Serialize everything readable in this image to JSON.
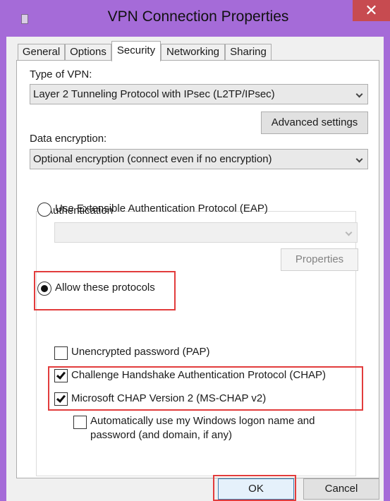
{
  "window": {
    "title": "VPN Connection Properties",
    "close_glyph": "✕"
  },
  "tabs": [
    {
      "label": "General",
      "active": false
    },
    {
      "label": "Options",
      "active": false
    },
    {
      "label": "Security",
      "active": true
    },
    {
      "label": "Networking",
      "active": false
    },
    {
      "label": "Sharing",
      "active": false
    }
  ],
  "security": {
    "vpn_type_label": "Type of VPN:",
    "vpn_type_value": "Layer 2 Tunneling Protocol with IPsec (L2TP/IPsec)",
    "advanced_settings_label": "Advanced settings",
    "data_encryption_label": "Data encryption:",
    "data_encryption_value": "Optional encryption (connect even if no encryption)",
    "authentication": {
      "group_label": "Authentication",
      "eap_label": "Use Extensible Authentication Protocol (EAP)",
      "eap_selected": false,
      "eap_dropdown_value": "",
      "properties_label": "Properties",
      "allow_label": "Allow these protocols",
      "allow_selected": true,
      "protocols": [
        {
          "label": "Unencrypted password (PAP)",
          "checked": false
        },
        {
          "label": "Challenge Handshake Authentication Protocol (CHAP)",
          "checked": true
        },
        {
          "label": "Microsoft CHAP Version 2 (MS-CHAP v2)",
          "checked": true
        }
      ],
      "auto_logon_line1": "Automatically use my Windows logon name and",
      "auto_logon_line2": "password (and domain, if any)",
      "auto_logon_checked": false
    }
  },
  "footer": {
    "ok_label": "OK",
    "cancel_label": "Cancel"
  },
  "colors": {
    "window_frame": "#a56bd8",
    "highlight": "#e23c3c",
    "close_button": "#c74b50"
  }
}
